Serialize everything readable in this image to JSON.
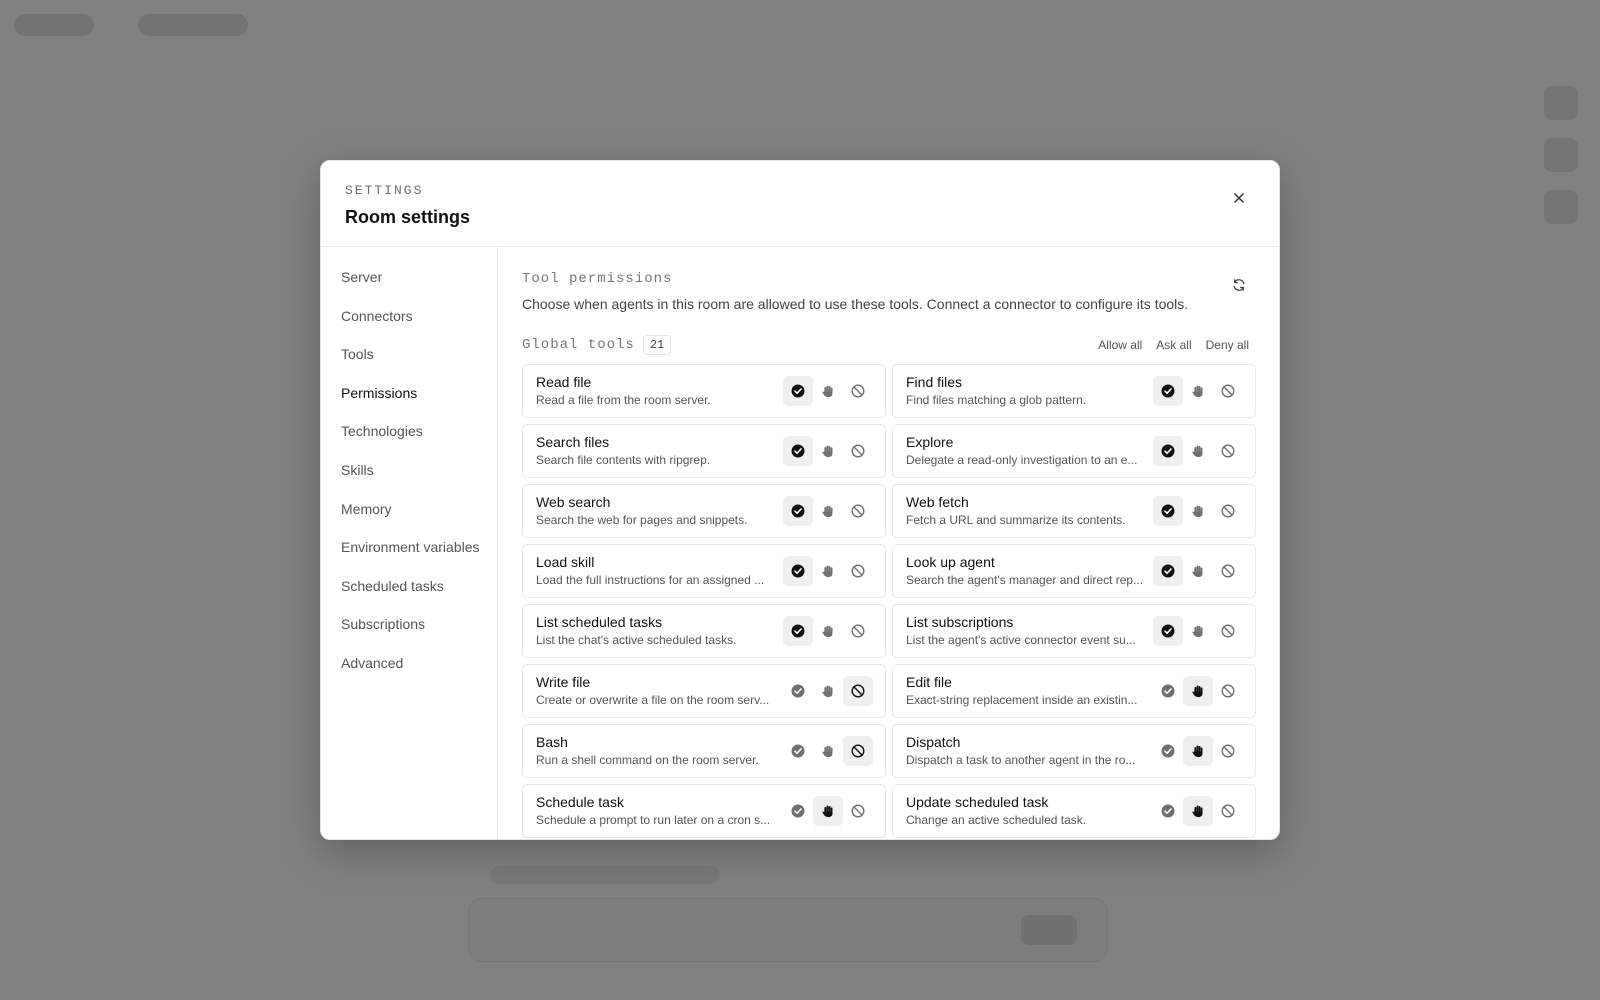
{
  "modal": {
    "eyebrow": "SETTINGS",
    "title": "Room settings"
  },
  "sidebar": {
    "items": [
      {
        "label": "Server"
      },
      {
        "label": "Connectors"
      },
      {
        "label": "Tools"
      },
      {
        "label": "Permissions",
        "active": true
      },
      {
        "label": "Technologies"
      },
      {
        "label": "Skills"
      },
      {
        "label": "Memory"
      },
      {
        "label": "Environment variables"
      },
      {
        "label": "Scheduled tasks"
      },
      {
        "label": "Subscriptions"
      },
      {
        "label": "Advanced"
      }
    ]
  },
  "permissions": {
    "title": "Tool permissions",
    "description": "Choose when agents in this room are allowed to use these tools. Connect a connector to configure its tools.",
    "group_title": "Global tools",
    "group_count": "21",
    "bulk": {
      "allow_all": "Allow all",
      "ask_all": "Ask all",
      "deny_all": "Deny all"
    },
    "tools": [
      {
        "name": "Read file",
        "desc": "Read a file from the room server.",
        "state": "allow"
      },
      {
        "name": "Find files",
        "desc": "Find files matching a glob pattern.",
        "state": "allow"
      },
      {
        "name": "Search files",
        "desc": "Search file contents with ripgrep.",
        "state": "allow"
      },
      {
        "name": "Explore",
        "desc": "Delegate a read-only investigation to an e...",
        "state": "allow"
      },
      {
        "name": "Web search",
        "desc": "Search the web for pages and snippets.",
        "state": "allow"
      },
      {
        "name": "Web fetch",
        "desc": "Fetch a URL and summarize its contents.",
        "state": "allow"
      },
      {
        "name": "Load skill",
        "desc": "Load the full instructions for an assigned ...",
        "state": "allow"
      },
      {
        "name": "Look up agent",
        "desc": "Search the agent's manager and direct rep...",
        "state": "allow"
      },
      {
        "name": "List scheduled tasks",
        "desc": "List the chat's active scheduled tasks.",
        "state": "allow"
      },
      {
        "name": "List subscriptions",
        "desc": "List the agent's active connector event su...",
        "state": "allow"
      },
      {
        "name": "Write file",
        "desc": "Create or overwrite a file on the room serv...",
        "state": "deny"
      },
      {
        "name": "Edit file",
        "desc": "Exact-string replacement inside an existin...",
        "state": "ask"
      },
      {
        "name": "Bash",
        "desc": "Run a shell command on the room server.",
        "state": "deny"
      },
      {
        "name": "Dispatch",
        "desc": "Dispatch a task to another agent in the ro...",
        "state": "ask"
      },
      {
        "name": "Schedule task",
        "desc": "Schedule a prompt to run later on a cron s...",
        "state": "ask"
      },
      {
        "name": "Update scheduled task",
        "desc": "Change an active scheduled task.",
        "state": "ask"
      }
    ]
  },
  "icons": {
    "close": "close-icon",
    "refresh": "refresh-icon",
    "allow": "check-circle-icon",
    "ask": "hand-icon",
    "deny": "ban-icon"
  },
  "colors": {
    "overlay": "#7c7c7c",
    "selected_bg": "#efefef",
    "text_primary": "#111111",
    "text_secondary": "#555555"
  }
}
